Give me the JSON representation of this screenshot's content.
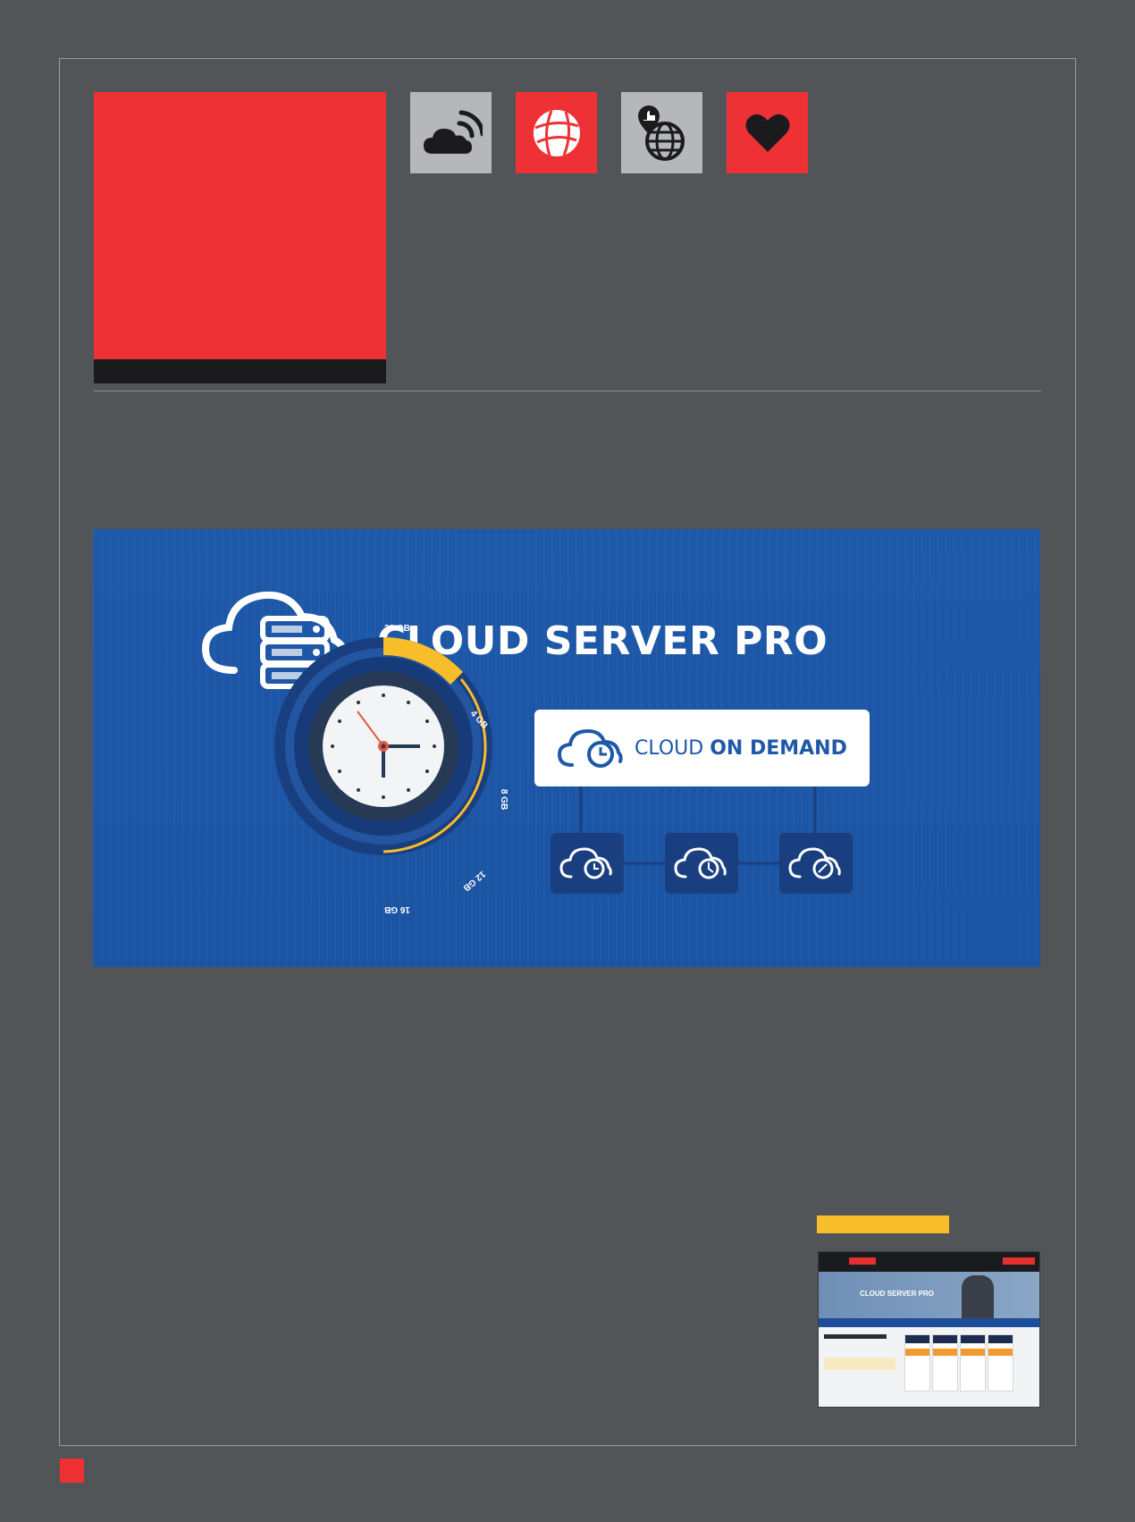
{
  "colors": {
    "page_bg": "#525557",
    "accent_red": "#ee3135",
    "tile_gray": "#b6b7b8",
    "banner_blue": "#1e58a8",
    "highlight_yellow": "#f8bd2a"
  },
  "icons": [
    "cloud-signal-icon",
    "globe-icon",
    "globe-thumbs-up-icon",
    "heart-icon"
  ],
  "banner": {
    "title": "CLOUD SERVER PRO",
    "on_demand_prefix": "CLOUD",
    "on_demand_bold": "ON DEMAND",
    "gauge_labels": [
      "32 GB",
      "4 GB",
      "8 GB",
      "12 GB",
      "16 GB"
    ]
  },
  "thumbnail": {
    "hero_title": "CLOUD SERVER PRO"
  }
}
